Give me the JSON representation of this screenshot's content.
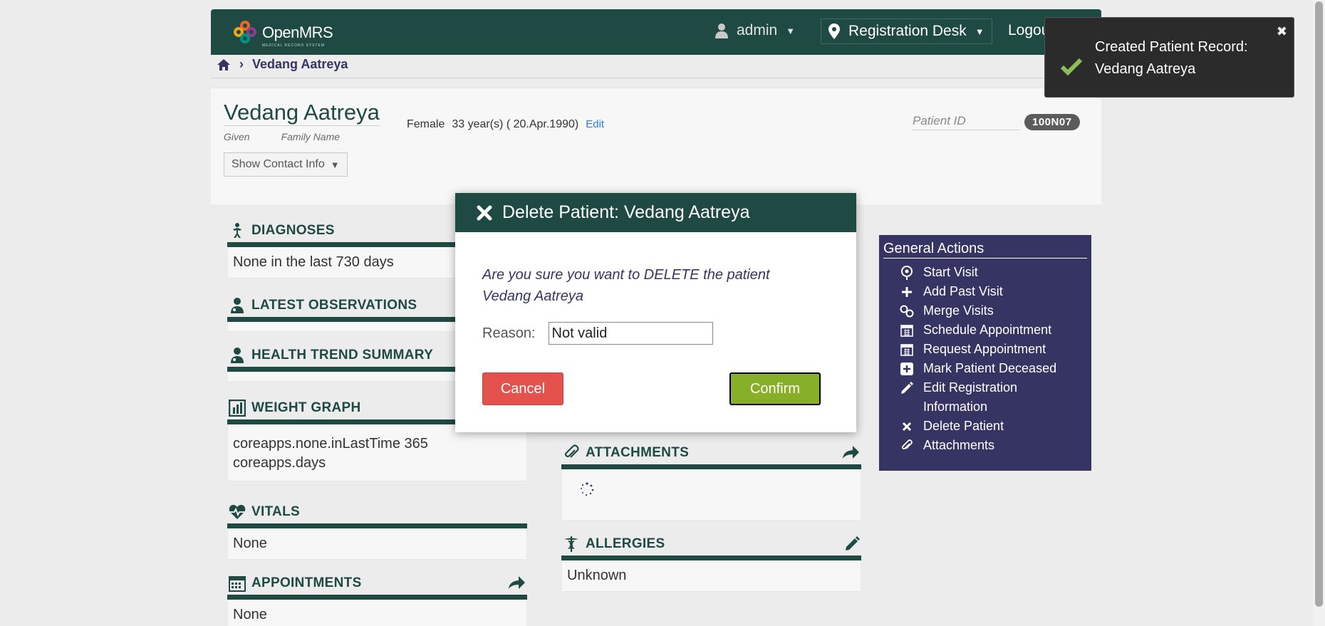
{
  "header": {
    "logo_text": "OpenMRS",
    "logo_subtext": "MEDICAL RECORD SYSTEM",
    "user": "admin",
    "location": "Registration Desk",
    "logout": "Logout"
  },
  "breadcrumb": {
    "current": "Vedang Aatreya"
  },
  "patient": {
    "name": "Vedang Aatreya",
    "given_label": "Given",
    "family_label": "Family Name",
    "gender": "Female",
    "age": "33 year(s) ( 20.Apr.1990)",
    "edit": "Edit",
    "id_label": "Patient ID",
    "id_value": "100N07",
    "contact_button": "Show Contact Info"
  },
  "widgets": {
    "diagnoses": {
      "title": "DIAGNOSES",
      "body": "None in the last 730 days"
    },
    "latest_obs": {
      "title": "LATEST OBSERVATIONS"
    },
    "health_trend": {
      "title": "HEALTH TREND SUMMARY"
    },
    "weight_graph": {
      "title": "WEIGHT GRAPH",
      "body": "coreapps.none.inLastTime 365 coreapps.days"
    },
    "vitals": {
      "title": "VITALS",
      "body": "None"
    },
    "appointments": {
      "title": "APPOINTMENTS",
      "body": "None"
    },
    "attachments": {
      "title": "ATTACHMENTS"
    },
    "allergies": {
      "title": "ALLERGIES",
      "body": "Unknown"
    }
  },
  "general_actions": {
    "title": "General Actions",
    "items": [
      {
        "label": "Start Visit",
        "icon": "map-pin-icon"
      },
      {
        "label": "Add Past Visit",
        "icon": "plus-icon"
      },
      {
        "label": "Merge Visits",
        "icon": "link-icon"
      },
      {
        "label": "Schedule Appointment",
        "icon": "calendar-icon"
      },
      {
        "label": "Request Appointment",
        "icon": "calendar-icon"
      },
      {
        "label": "Mark Patient Deceased",
        "icon": "plus-square-icon"
      },
      {
        "label": "Edit Registration Information",
        "icon": "pencil-icon"
      },
      {
        "label": "Delete Patient",
        "icon": "x-icon"
      },
      {
        "label": "Attachments",
        "icon": "paperclip-icon"
      }
    ]
  },
  "modal": {
    "title": "Delete Patient: Vedang Aatreya",
    "message": "Are you sure you want to DELETE the patient Vedang Aatreya",
    "reason_label": "Reason:",
    "reason_value": "Not valid",
    "cancel": "Cancel",
    "confirm": "Confirm"
  },
  "toast": {
    "message": "Created Patient Record: Vedang Aatreya",
    "close": "✖"
  },
  "colors": {
    "header_bg": "#1f4a43",
    "actions_bg": "#363463",
    "cancel_bg": "#e4524d",
    "confirm_bg": "#88af28"
  }
}
